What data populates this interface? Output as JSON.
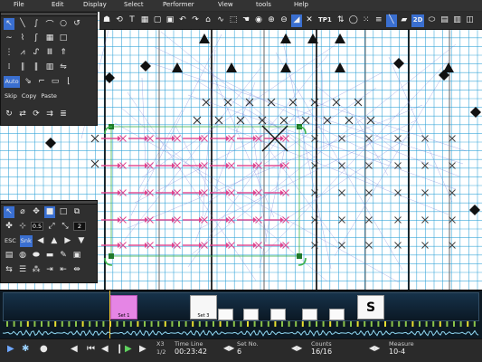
{
  "menu": [
    "File",
    "Edit",
    "Display",
    "Select",
    "Performer",
    "View",
    "tools",
    "Help"
  ],
  "toolbar": {
    "icons": [
      "perform-icon",
      "rotate-icon",
      "text-icon",
      "grid-icon",
      "window-icon",
      "save-icon",
      "undo-icon",
      "redo-icon",
      "lock-icon",
      "curve-icon",
      "select-icon",
      "cursor-icon",
      "zoom-in-icon",
      "zoom-out-icon",
      "fit-icon",
      "paint-icon",
      "close-icon"
    ],
    "tp_label": "TP1",
    "mode_2d": "2D"
  },
  "palette_top": {
    "auto_label": "Auto",
    "skip_label": "Skip",
    "copy_label": "Copy",
    "paste_label": "Paste"
  },
  "palette_bottom": {
    "stroke_value": "0.5",
    "count_value": "2",
    "esc_label": "ESC",
    "snk_label": "Snk"
  },
  "timeline": {
    "markers": [
      "Set 1",
      "Set 3"
    ]
  },
  "transport": {
    "speed_label": "X3",
    "speed_sub": "1/2",
    "timeline_label": "Time Line",
    "timeline_value": "00:23:42",
    "setno_label": "Set No.",
    "setno_value": "6",
    "counts_label": "Counts",
    "counts_value": "16/16",
    "measure_label": "Measure",
    "measure_value": "10-4"
  },
  "colors": {
    "grid": "#2a9fd6",
    "grid_major": "#000000",
    "path": "#e0448f",
    "selection": "#3db24a",
    "accent": "#3a6fd0"
  }
}
